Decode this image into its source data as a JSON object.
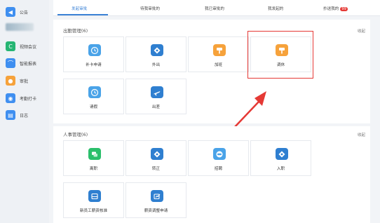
{
  "sidebar": {
    "items": [
      {
        "label": "公告",
        "icon": "speaker-icon",
        "color": "#3f8ff0"
      },
      {
        "label": "",
        "icon": "blurred-item",
        "color": "#9fb6c6"
      },
      {
        "label": "视频会议",
        "icon": "video-call-icon",
        "color": "#26b573"
      },
      {
        "label": "智能报表",
        "icon": "report-chart-icon",
        "color": "#3f8ff0"
      },
      {
        "label": "审批",
        "icon": "approval-person-icon",
        "color": "#f6a23b"
      },
      {
        "label": "考勤打卡",
        "icon": "location-pin-icon",
        "color": "#3f8ff0"
      },
      {
        "label": "日志",
        "icon": "log-document-icon",
        "color": "#3f8ff0"
      }
    ]
  },
  "tabs": [
    {
      "label": "发起审批",
      "active": true
    },
    {
      "label": "待我审批的",
      "active": false
    },
    {
      "label": "我已审批的",
      "active": false
    },
    {
      "label": "我发起的",
      "active": false
    },
    {
      "label": "抄送我的",
      "active": false,
      "badge": "99"
    }
  ],
  "sections": [
    {
      "title": "出勤管理(6)",
      "collapse": "收起",
      "cards": [
        {
          "label": "补卡申请",
          "icon": "clock-icon",
          "color": "#4aa3e8"
        },
        {
          "label": "外出",
          "icon": "diamond-icon",
          "color": "#2f7fd0"
        },
        {
          "label": "加班",
          "icon": "paint-roller-icon",
          "color": "#f6a23b"
        },
        {
          "label": "调休",
          "icon": "paint-roller-icon",
          "color": "#f6a23b"
        },
        {
          "label": "请假",
          "icon": "clock-icon",
          "color": "#4aa3e8"
        },
        {
          "label": "出差",
          "icon": "airplane-icon",
          "color": "#2f7fd0"
        }
      ]
    },
    {
      "title": "人事管理(6)",
      "collapse": "收起",
      "cards": [
        {
          "label": "离职",
          "icon": "chat-bubbles-icon",
          "color": "#2bbf6b"
        },
        {
          "label": "转正",
          "icon": "diamond-icon",
          "color": "#2f7fd0"
        },
        {
          "label": "招聘",
          "icon": "target-icon",
          "color": "#4aa3e8"
        },
        {
          "label": "入职",
          "icon": "diamond-icon",
          "color": "#2f7fd0"
        },
        {
          "label": "新员工薪资核准",
          "icon": "calendar-icon",
          "color": "#2f7fd0"
        },
        {
          "label": "薪资调整申请",
          "icon": "edit-chart-icon",
          "color": "#2f7fd0"
        }
      ]
    }
  ]
}
